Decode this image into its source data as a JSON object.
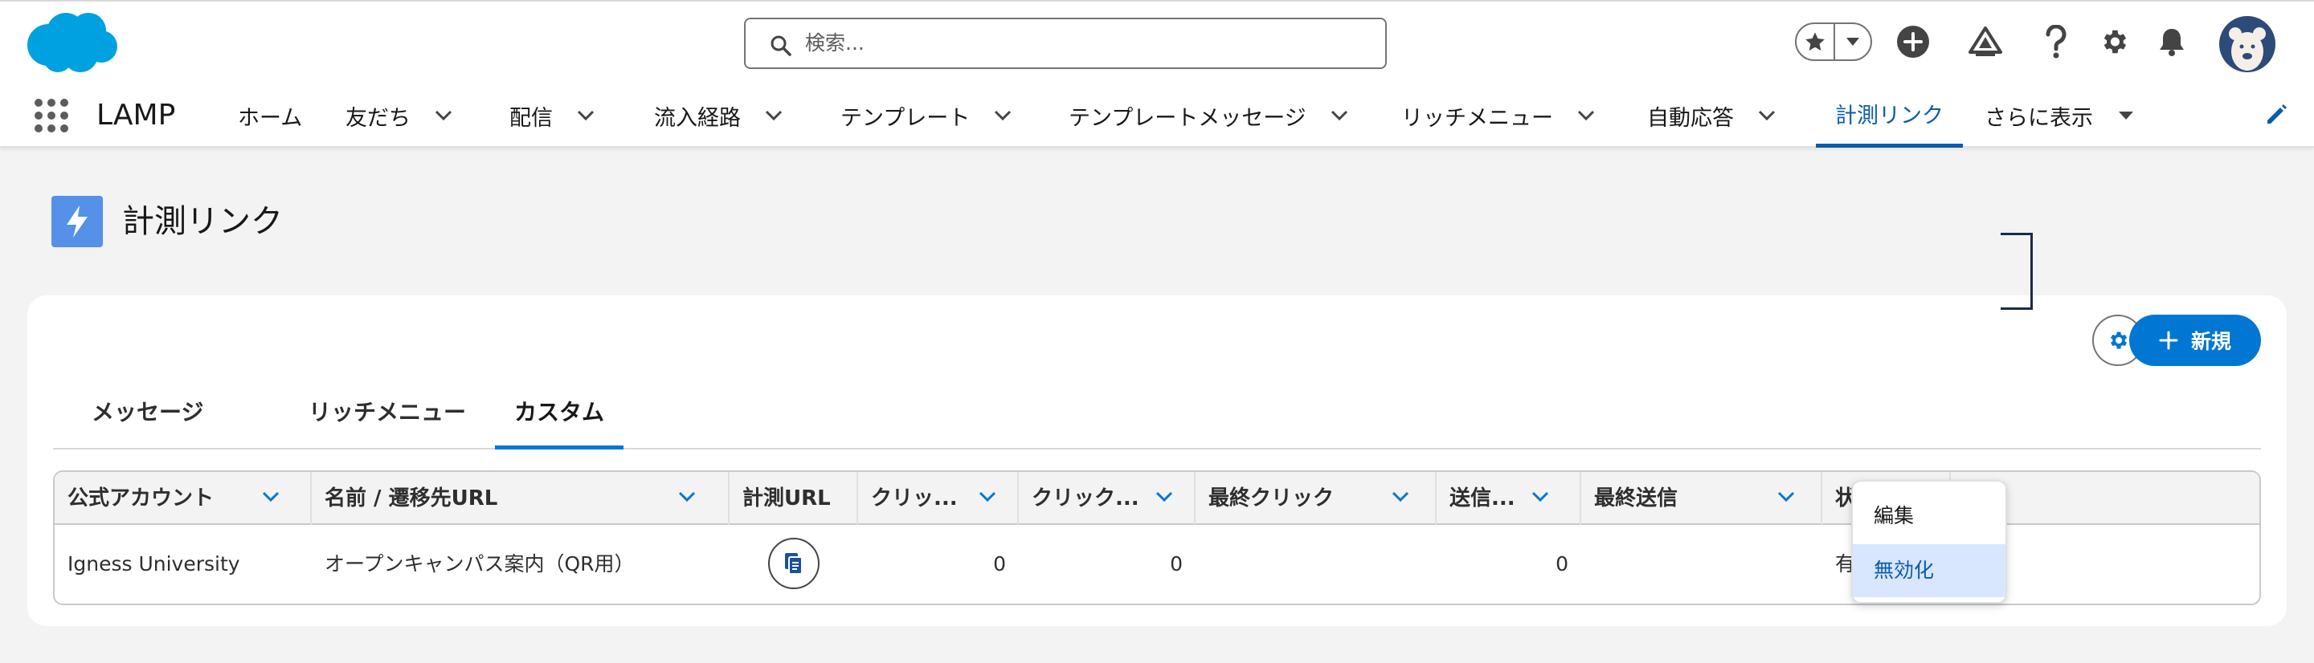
{
  "header": {
    "search": {
      "placeholder": "検索..."
    },
    "avatar_icon": "bear-avatar-icon"
  },
  "nav": {
    "app_name": "LAMP",
    "items": [
      {
        "label": "ホーム",
        "dropdown": false
      },
      {
        "label": "友だち",
        "dropdown": true
      },
      {
        "label": "配信",
        "dropdown": true
      },
      {
        "label": "流入経路",
        "dropdown": true
      },
      {
        "label": "テンプレート",
        "dropdown": true
      },
      {
        "label": "テンプレートメッセージ",
        "dropdown": true
      },
      {
        "label": "リッチメニュー",
        "dropdown": true
      },
      {
        "label": "自動応答",
        "dropdown": true
      },
      {
        "label": "計測リンク",
        "dropdown": false,
        "active": true
      },
      {
        "label": "さらに表示",
        "dropdown": true
      }
    ]
  },
  "page": {
    "title": "計測リンク",
    "new_button": "新規"
  },
  "tabs": [
    "メッセージ",
    "リッチメニュー",
    "カスタム"
  ],
  "active_tab": "カスタム",
  "table": {
    "columns": [
      "公式アカウント",
      "名前 / 遷移先URL",
      "計測URL",
      "クリッ...",
      "クリック...",
      "最終クリック",
      "送信...",
      "最終送信",
      "状"
    ],
    "rows": [
      {
        "account": "Igness University",
        "name": "オープンキャンパス案内（QR用）",
        "clicks": "0",
        "unique_clicks": "0",
        "last_click": "",
        "sent": "0",
        "last_sent": "",
        "status": "有"
      }
    ]
  },
  "row_menu": {
    "items": [
      "編集",
      "無効化"
    ],
    "highlighted": "無効化"
  },
  "colors": {
    "brand": "#0176d3",
    "active_nav": "#0b5cab",
    "page_icon_bg": "#5590e9",
    "salesforce_cloud": "#00a1e0"
  }
}
